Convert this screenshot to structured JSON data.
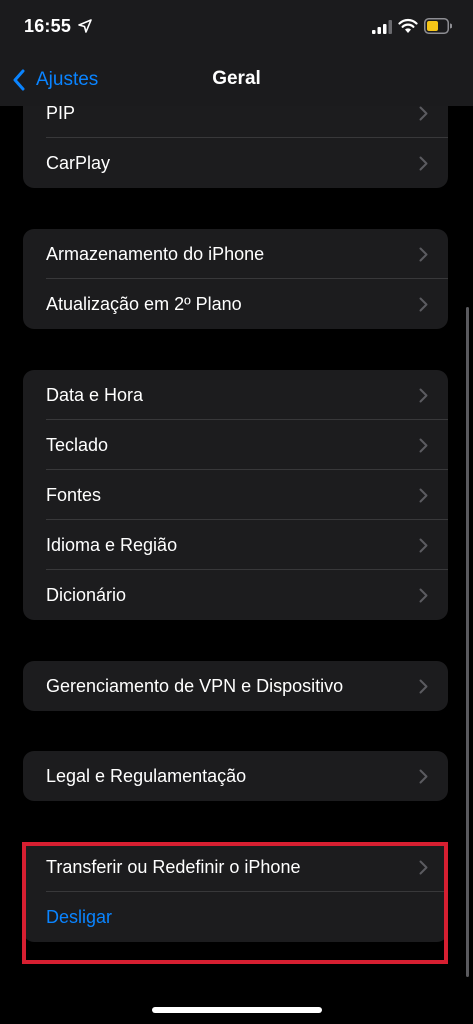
{
  "status_bar": {
    "time": "16:55",
    "icons": [
      "location-arrow-icon",
      "cellular-signal-icon",
      "wifi-icon",
      "battery-icon"
    ],
    "battery_color": "#f5c518"
  },
  "nav": {
    "back_label": "Ajustes",
    "title": "Geral"
  },
  "groups": [
    {
      "items": [
        "PIP",
        "CarPlay"
      ]
    },
    {
      "items": [
        "Armazenamento do iPhone",
        "Atualização em 2º Plano"
      ]
    },
    {
      "items": [
        "Data e Hora",
        "Teclado",
        "Fontes",
        "Idioma e Região",
        "Dicionário"
      ]
    },
    {
      "items": [
        "Gerenciamento de VPN e Dispositivo"
      ]
    },
    {
      "items": [
        "Legal e Regulamentação"
      ]
    },
    {
      "items": [
        "Transferir ou Redefinir o iPhone",
        "Desligar"
      ]
    }
  ],
  "colors": {
    "accent": "#0a84ff",
    "background": "#000000",
    "cell": "#1c1c1e",
    "highlight": "#d61f31"
  }
}
